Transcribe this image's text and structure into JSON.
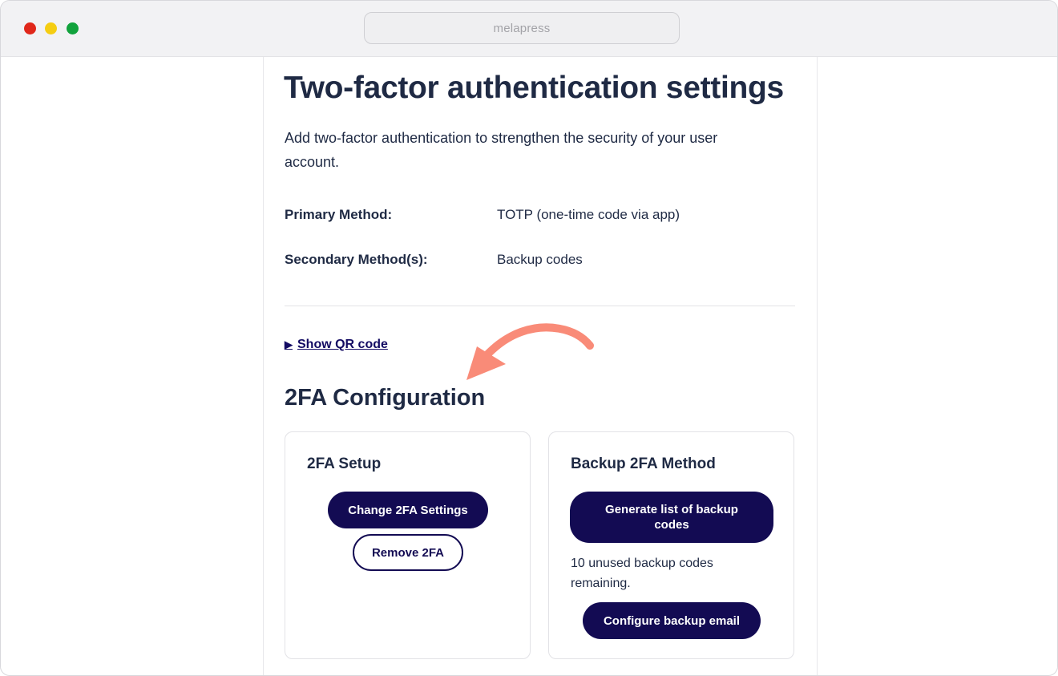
{
  "browser": {
    "url": "melapress"
  },
  "page": {
    "title": "Two-factor authentication settings",
    "description": "Add two-factor authentication to strengthen the security of your user account.",
    "methods": [
      {
        "label": "Primary Method:",
        "value": "TOTP (one-time code via app)"
      },
      {
        "label": "Secondary Method(s):",
        "value": "Backup codes"
      }
    ],
    "qr_toggle": {
      "icon": "triangle-right-icon",
      "label": "Show QR code"
    },
    "section_title": "2FA Configuration"
  },
  "cards": {
    "setup": {
      "title": "2FA Setup",
      "change_button": "Change 2FA Settings",
      "remove_button": "Remove 2FA"
    },
    "backup": {
      "title": "Backup 2FA Method",
      "generate_button": "Generate list of backup codes",
      "remaining_text": "10 unused backup codes remaining.",
      "email_button": "Configure backup email"
    }
  },
  "annotation": {
    "icon": "curved-arrow-icon",
    "color": "#f98b78"
  },
  "colors": {
    "primary_button": "#130b53",
    "text": "#1f2a44",
    "link": "#130b63"
  }
}
